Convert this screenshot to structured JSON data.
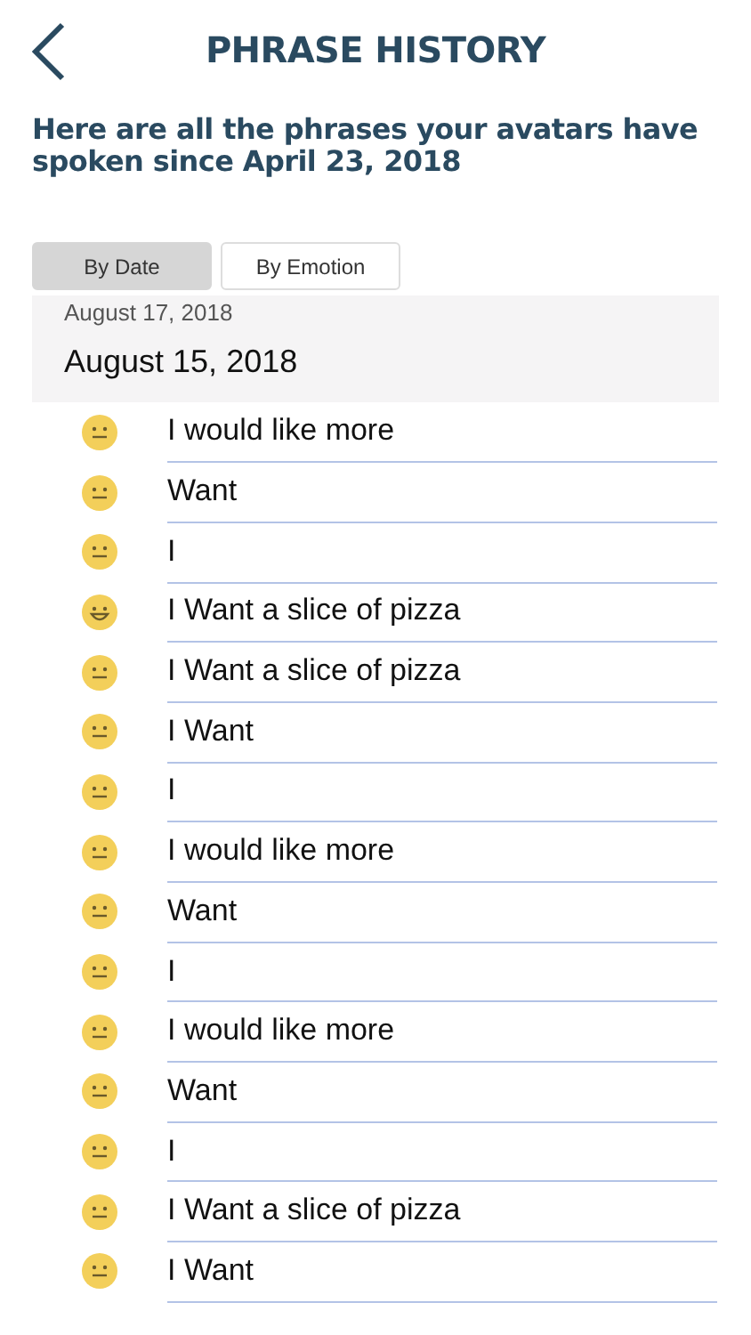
{
  "header": {
    "title": "PHRASE HISTORY"
  },
  "intro": "Here are all the phrases your avatars have spoken since April 23, 2018",
  "tabs": [
    {
      "label": "By Date",
      "selected": true
    },
    {
      "label": "By Emotion",
      "selected": false
    }
  ],
  "sections": [
    {
      "date": "August 17, 2018"
    },
    {
      "date": "August 15, 2018",
      "phrases": [
        {
          "text": "I would like more",
          "kind": "neutral"
        },
        {
          "text": "Want",
          "kind": "neutral"
        },
        {
          "text": "I",
          "kind": "neutral"
        },
        {
          "text": "I Want a slice of pizza",
          "kind": "happy"
        },
        {
          "text": "I Want a slice of pizza",
          "kind": "neutral"
        },
        {
          "text": "I Want",
          "kind": "neutral"
        },
        {
          "text": "I",
          "kind": "neutral"
        },
        {
          "text": "I would like more",
          "kind": "neutral"
        },
        {
          "text": "Want",
          "kind": "neutral"
        },
        {
          "text": "I",
          "kind": "neutral"
        },
        {
          "text": "I would like more",
          "kind": "neutral"
        },
        {
          "text": "Want",
          "kind": "neutral"
        },
        {
          "text": "I",
          "kind": "neutral"
        },
        {
          "text": "I Want a slice of pizza",
          "kind": "neutral"
        },
        {
          "text": "I Want",
          "kind": "neutral"
        }
      ]
    }
  ]
}
